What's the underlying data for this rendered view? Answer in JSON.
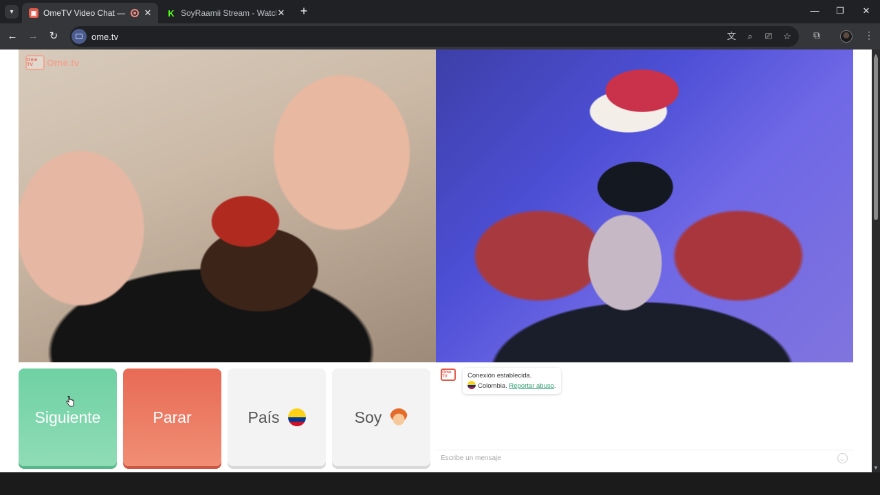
{
  "browser": {
    "tabs": [
      {
        "title": "OmeTV Video Chat — Omegle",
        "active": true,
        "recording": true
      },
      {
        "title": "SoyRaamii Stream - Watch Live",
        "active": false
      }
    ],
    "url": "ome.tv"
  },
  "app": {
    "logo_text": "Ome.tv",
    "logo_box": "Ome TV"
  },
  "buttons": {
    "next": "Siguiente",
    "stop": "Parar",
    "country": "País",
    "gender": "Soy"
  },
  "chat": {
    "avatar_text": "Ome TV",
    "status": "Conexión establecida.",
    "country": "Colombia.",
    "report_link": "Reportar abuso",
    "report_suffix": ".",
    "input_placeholder": "Escribe un mensaje"
  },
  "colors": {
    "next_button": "#6fd1a3",
    "stop_button": "#e86a55",
    "link": "#2a9d72",
    "brand": "#e35b4b"
  }
}
